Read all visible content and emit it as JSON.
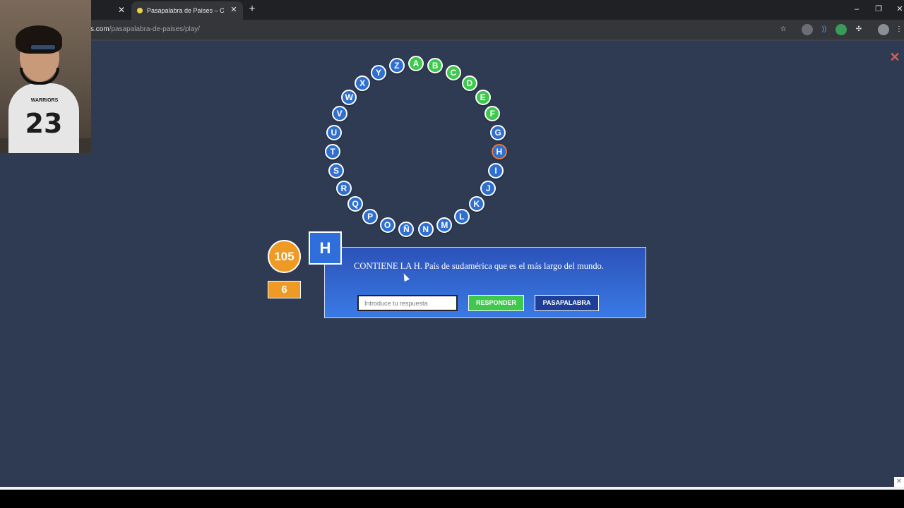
{
  "browser": {
    "tab_title": "Pasapalabra de Países – COKITO",
    "prev_tab_close": "✕",
    "tab_close": "✕",
    "new_tab": "+",
    "url_host": "s.com",
    "url_path": "/pasapalabra-de-paises/play/",
    "window_controls": {
      "minimize": "–",
      "restore": "❐",
      "close": "✕"
    }
  },
  "game": {
    "close_symbol": "✕",
    "score": "105",
    "timer": "6",
    "current_letter": "H",
    "question": "CONTIENE LA H. País de sudamérica que es el más largo del mundo.",
    "answer_placeholder": "Introduce tu respuesta",
    "answer_value": "",
    "respond_label": "RESPONDER",
    "pass_label": "PASAPALABRA",
    "rosco": [
      {
        "letter": "A",
        "status": "correct"
      },
      {
        "letter": "B",
        "status": "correct"
      },
      {
        "letter": "C",
        "status": "correct"
      },
      {
        "letter": "D",
        "status": "correct"
      },
      {
        "letter": "E",
        "status": "correct"
      },
      {
        "letter": "F",
        "status": "correct"
      },
      {
        "letter": "G",
        "status": "pending"
      },
      {
        "letter": "H",
        "status": "current"
      },
      {
        "letter": "I",
        "status": "pending"
      },
      {
        "letter": "J",
        "status": "pending"
      },
      {
        "letter": "K",
        "status": "pending"
      },
      {
        "letter": "L",
        "status": "pending"
      },
      {
        "letter": "M",
        "status": "pending"
      },
      {
        "letter": "N",
        "status": "pending"
      },
      {
        "letter": "Ñ",
        "status": "pending"
      },
      {
        "letter": "O",
        "status": "pending"
      },
      {
        "letter": "P",
        "status": "pending"
      },
      {
        "letter": "Q",
        "status": "pending"
      },
      {
        "letter": "R",
        "status": "pending"
      },
      {
        "letter": "S",
        "status": "pending"
      },
      {
        "letter": "T",
        "status": "pending"
      },
      {
        "letter": "U",
        "status": "pending"
      },
      {
        "letter": "V",
        "status": "pending"
      },
      {
        "letter": "W",
        "status": "pending"
      },
      {
        "letter": "X",
        "status": "pending"
      },
      {
        "letter": "Y",
        "status": "pending"
      },
      {
        "letter": "Z",
        "status": "pending"
      }
    ]
  },
  "webcam": {
    "shirt_word": "WARRIORS",
    "shirt_number": "23"
  },
  "colors": {
    "page_bg": "#2e3b52",
    "correct": "#3ec84d",
    "pending": "#2f6fcf",
    "current_ring": "#e27a3f",
    "score_orange": "#ee9a25"
  }
}
